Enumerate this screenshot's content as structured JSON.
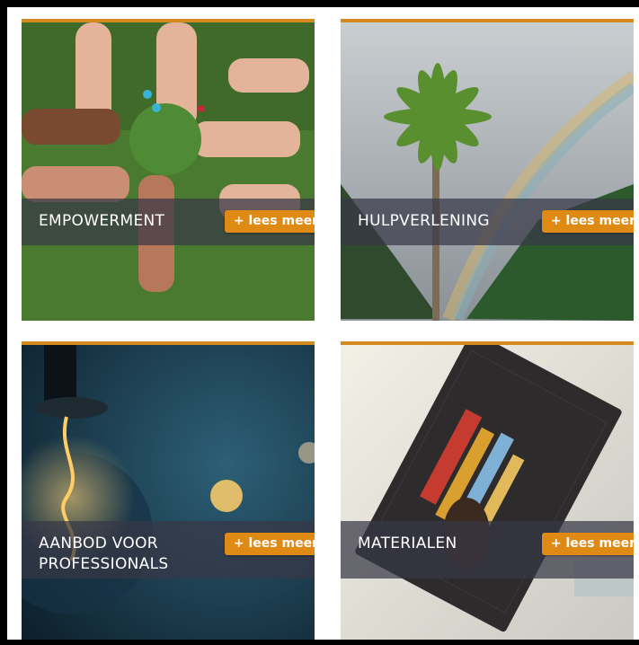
{
  "cards": [
    {
      "title_lines": [
        "EMPOWERMENT"
      ],
      "button": "+ lees meer",
      "image": "hands-circle-grass-photo"
    },
    {
      "title_lines": [
        "HULPVERLENING"
      ],
      "button": "+ lees meer",
      "image": "palm-tree-rainbow-photo"
    },
    {
      "title_lines": [
        "AANBOD VOOR",
        "PROFESSIONALS"
      ],
      "button": "+ lees meer",
      "image": "light-bulb-photo"
    },
    {
      "title_lines": [
        "MATERIALEN"
      ],
      "button": "+ lees meer",
      "image": "hand-holding-book-photo"
    }
  ],
  "colors": {
    "accent": "#e08a16",
    "border_top": "#d48a1f",
    "overlay": "rgba(55,55,70,0.72)"
  }
}
